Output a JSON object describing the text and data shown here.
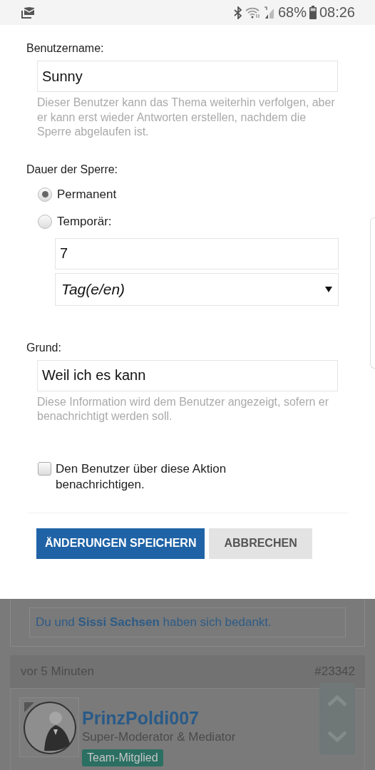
{
  "status_bar": {
    "battery": "68%",
    "time": "08:26"
  },
  "dialog": {
    "username": {
      "label": "Benutzername:",
      "value": "Sunny",
      "help": "Dieser Benutzer kann das Thema weiterhin verfolgen, aber er kann erst wieder Antworten erstellen, nachdem die Sperre abgelaufen ist."
    },
    "duration": {
      "label": "Dauer der Sperre:",
      "options": [
        {
          "label": "Permanent",
          "selected": true
        },
        {
          "label": "Temporär:",
          "selected": false
        }
      ],
      "amount": "7",
      "unit": "Tag(e/en)"
    },
    "reason": {
      "label": "Grund:",
      "value": "Weil ich es kann",
      "help": "Diese Information wird dem Benutzer angezeigt, sofern er benachrichtigt werden soll."
    },
    "notify": {
      "label": "Den Benutzer über diese Aktion benachrichtigen.",
      "checked": false
    },
    "buttons": [
      {
        "label": "ÄNDERUNGEN SPEICHERN",
        "kind": "primary"
      },
      {
        "label": "ABBRECHEN",
        "kind": "secondary"
      }
    ]
  },
  "background": {
    "thanks": "Du und **Sissi Sachsen** haben sich bedankt.",
    "post": {
      "time": "vor 5 Minuten",
      "number": "#23342",
      "author": "PrinzPoldi007",
      "role": "Super-Moderator & Mediator",
      "badge": "Team-Mitglied"
    }
  }
}
